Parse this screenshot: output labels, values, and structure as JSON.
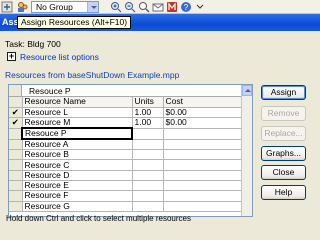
{
  "toolbar": {
    "group_value": "No Group",
    "icons": [
      "expand-icon",
      "zoom-in-icon",
      "zoom-out-icon",
      "search-icon",
      "email-icon",
      "resource-icon",
      "help-icon",
      "more-icon"
    ]
  },
  "dialog": {
    "title_partial": "Ass",
    "tooltip": "Assign Resources (Alt+F10)",
    "task_label": "Task: Bldg 700",
    "options_toggle": "+",
    "options_link": "Resource list options",
    "resources_from": "Resources from baseShutDown Example.mpp"
  },
  "grid": {
    "entry_value": "Resouce P",
    "columns": [
      "Resource Name",
      "Units",
      "Cost"
    ],
    "rows": [
      {
        "check": "✔",
        "name": "Resource L",
        "units": "1.00",
        "cost": "$0.00"
      },
      {
        "check": "✔",
        "name": "Resource M",
        "units": "1.00",
        "cost": "$0.00"
      },
      {
        "check": "",
        "name": "Resouce P",
        "units": "",
        "cost": ""
      },
      {
        "check": "",
        "name": "Resource A",
        "units": "",
        "cost": ""
      },
      {
        "check": "",
        "name": "Resource B",
        "units": "",
        "cost": ""
      },
      {
        "check": "",
        "name": "Resource C",
        "units": "",
        "cost": ""
      },
      {
        "check": "",
        "name": "Resource D",
        "units": "",
        "cost": ""
      },
      {
        "check": "",
        "name": "Resource E",
        "units": "",
        "cost": ""
      },
      {
        "check": "",
        "name": "Resource F",
        "units": "",
        "cost": ""
      },
      {
        "check": "",
        "name": "Resource G",
        "units": "",
        "cost": ""
      }
    ]
  },
  "buttons": {
    "assign": "Assign",
    "remove": "Remove",
    "replace": "Replace...",
    "graphs": "Graphs...",
    "close": "Close",
    "help": "Help"
  },
  "footer": {
    "hint": "Hold down Ctrl and click to select multiple resources"
  },
  "colors": {
    "titlebar": "#0b4bd1",
    "tooltip_bg": "#ffffe1",
    "link": "#0033cc",
    "dialog_bg": "#ece9d8"
  }
}
